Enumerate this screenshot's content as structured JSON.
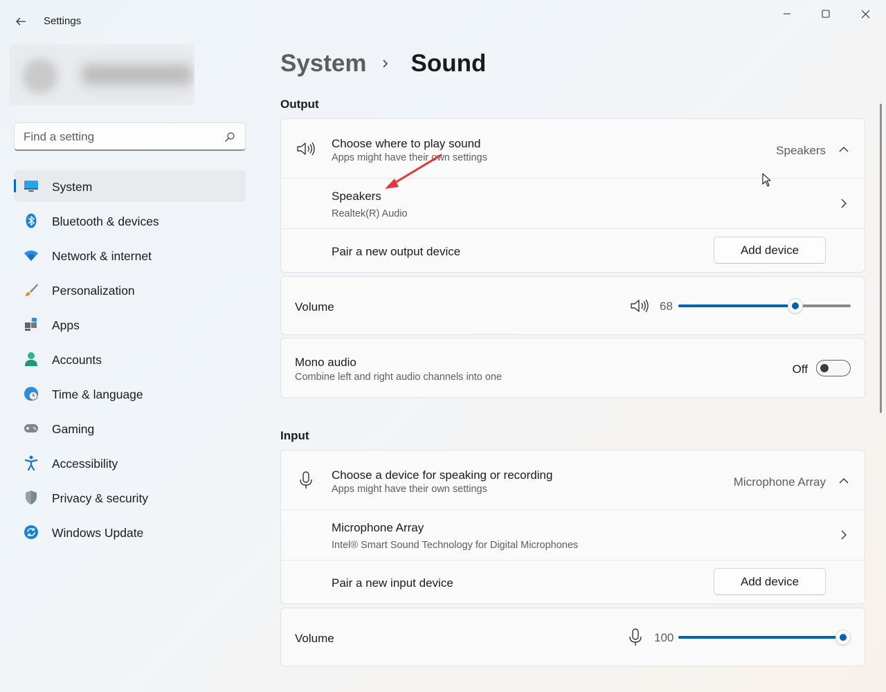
{
  "window": {
    "title": "Settings",
    "back_icon": "arrow-left-icon",
    "controls": [
      "minimize-icon",
      "maximize-icon",
      "close-icon"
    ]
  },
  "search": {
    "placeholder": "Find a setting",
    "value": "",
    "icon": "search-icon"
  },
  "sidebar": {
    "items": [
      {
        "label": "System",
        "icon": "monitor-icon",
        "selected": true
      },
      {
        "label": "Bluetooth & devices",
        "icon": "bluetooth-icon"
      },
      {
        "label": "Network & internet",
        "icon": "wifi-icon"
      },
      {
        "label": "Personalization",
        "icon": "brush-icon"
      },
      {
        "label": "Apps",
        "icon": "apps-icon"
      },
      {
        "label": "Accounts",
        "icon": "person-icon"
      },
      {
        "label": "Time & language",
        "icon": "globe-clock-icon"
      },
      {
        "label": "Gaming",
        "icon": "gamepad-icon"
      },
      {
        "label": "Accessibility",
        "icon": "accessibility-icon"
      },
      {
        "label": "Privacy & security",
        "icon": "shield-icon"
      },
      {
        "label": "Windows Update",
        "icon": "update-icon"
      }
    ]
  },
  "breadcrumb": {
    "parent": "System",
    "current": "Sound"
  },
  "output": {
    "section_title": "Output",
    "choose": {
      "title": "Choose where to play sound",
      "subtitle": "Apps might have their own settings",
      "value": "Speakers",
      "icon": "speaker-icon"
    },
    "device": {
      "title": "Speakers",
      "subtitle": "Realtek(R) Audio"
    },
    "pair": {
      "label": "Pair a new output device",
      "button": "Add device"
    },
    "volume": {
      "label": "Volume",
      "value": "68",
      "level": 0.68,
      "icon": "speaker-icon"
    },
    "mono": {
      "title": "Mono audio",
      "subtitle": "Combine left and right audio channels into one",
      "state": "Off"
    }
  },
  "input": {
    "section_title": "Input",
    "choose": {
      "title": "Choose a device for speaking or recording",
      "subtitle": "Apps might have their own settings",
      "value": "Microphone Array",
      "icon": "microphone-icon"
    },
    "device": {
      "title": "Microphone Array",
      "subtitle": "Intel® Smart Sound Technology for Digital Microphones"
    },
    "pair": {
      "label": "Pair a new input device",
      "button": "Add device"
    },
    "volume": {
      "label": "Volume",
      "value": "100",
      "level": 1.0,
      "icon": "microphone-icon"
    }
  },
  "colors": {
    "accent": "#0063b1",
    "annotation_arrow": "#e0383b"
  }
}
